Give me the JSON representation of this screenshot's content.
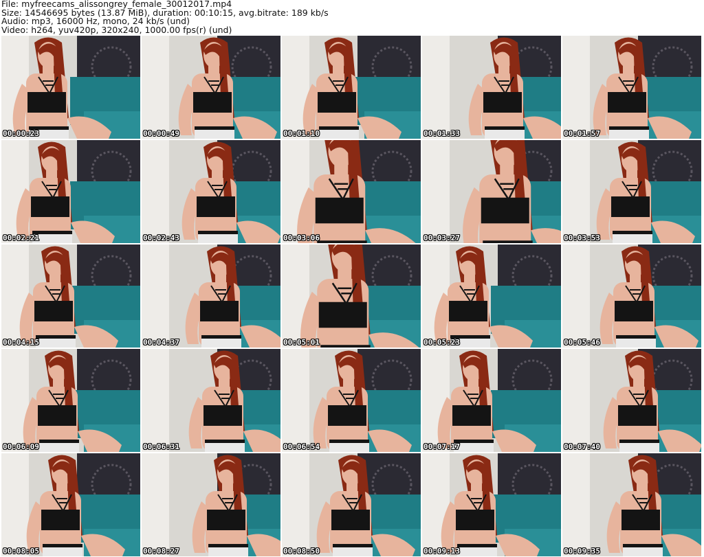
{
  "header": {
    "line1": "File: myfreecams_alissongrey_female_30012017.mp4",
    "line2": "Size: 14546695 bytes (13.87 MiB), duration: 00:10:15, avg.bitrate: 189 kb/s",
    "line3": "Audio: mp3, 16000 Hz, mono, 24 kb/s (und)",
    "line4": "Video: h264, yuv420p, 320x240, 1000.00 fps(r) (und)"
  },
  "thumbnails": [
    {
      "timestamp": "00:00:23"
    },
    {
      "timestamp": "00:00:49"
    },
    {
      "timestamp": "00:01:10"
    },
    {
      "timestamp": "00:01:33"
    },
    {
      "timestamp": "00:01:57"
    },
    {
      "timestamp": "00:02:21"
    },
    {
      "timestamp": "00:02:43"
    },
    {
      "timestamp": "00:03:06"
    },
    {
      "timestamp": "00:03:27"
    },
    {
      "timestamp": "00:03:53"
    },
    {
      "timestamp": "00:04:15"
    },
    {
      "timestamp": "00:04:37"
    },
    {
      "timestamp": "00:05:01"
    },
    {
      "timestamp": "00:05:23"
    },
    {
      "timestamp": "00:05:46"
    },
    {
      "timestamp": "00:06:09"
    },
    {
      "timestamp": "00:06:31"
    },
    {
      "timestamp": "00:06:54"
    },
    {
      "timestamp": "00:07:17"
    },
    {
      "timestamp": "00:07:40"
    },
    {
      "timestamp": "00:08:05"
    },
    {
      "timestamp": "00:08:27"
    },
    {
      "timestamp": "00:08:50"
    },
    {
      "timestamp": "00:09:13"
    },
    {
      "timestamp": "00:09:35"
    }
  ],
  "colors": {
    "wall": "#d9d7d2",
    "teal": "#1f7d85",
    "skin": "#e7b49d",
    "hair": "#8a2a14",
    "top": "#141414",
    "tapestry": "#2b2a33"
  }
}
